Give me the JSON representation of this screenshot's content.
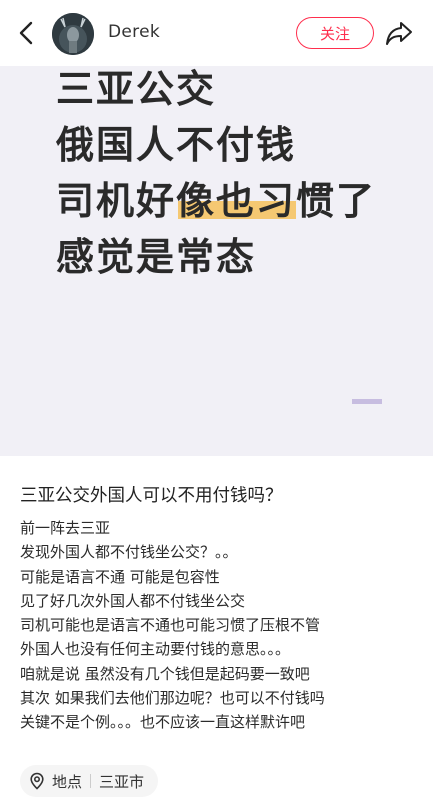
{
  "header": {
    "username": "Derek",
    "follow_label": "关注"
  },
  "cover": {
    "lines": [
      "三亚公交",
      "俄国人不付钱",
      "司机好像也习惯了",
      "感觉是常态"
    ]
  },
  "post": {
    "title": "三亚公交外国人可以不用付钱吗？",
    "body": [
      "前一阵去三亚",
      "发现外国人都不付钱坐公交？。。",
      "可能是语言不通 可能是包容性",
      "见了好几次外国人都不付钱坐公交",
      "司机可能也是语言不通也可能习惯了压根不管",
      "外国人也没有任何主动要付钱的意思。。。",
      "咱就是说 虽然没有几个钱但是起码要一致吧",
      "其次 如果我们去他们那边呢？也可以不付钱吗",
      "关键不是个例。。。也不应该一直这样默许吧"
    ]
  },
  "location": {
    "label": "地点",
    "value": "三亚市"
  },
  "colors": {
    "accent": "#ff2e4d",
    "highlight": "#f6c15b",
    "cover_bg": "#f1f0f6"
  }
}
